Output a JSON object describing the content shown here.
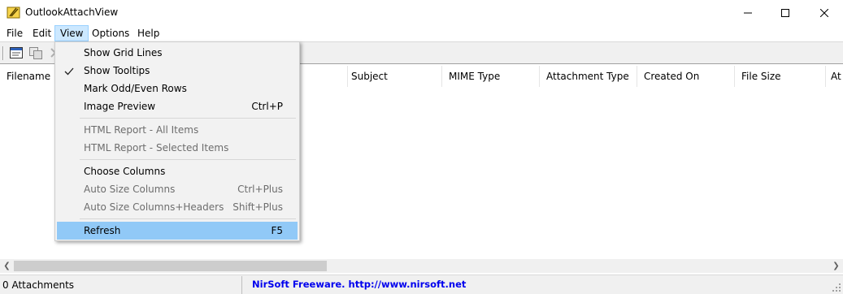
{
  "window": {
    "title": "OutlookAttachView",
    "controls": {
      "minimize": "minimize-icon",
      "maximize": "maximize-icon",
      "close": "close-icon"
    }
  },
  "menubar": {
    "items": [
      {
        "label": "File"
      },
      {
        "label": "Edit"
      },
      {
        "label": "View",
        "active": true
      },
      {
        "label": "Options"
      },
      {
        "label": "Help"
      }
    ]
  },
  "toolbar": {
    "buttons": [
      "properties-icon",
      "copy-icon",
      "delete-icon"
    ]
  },
  "columns": [
    "Filename",
    "Subject",
    "MIME Type",
    "Attachment Type",
    "Created On",
    "File Size",
    "At"
  ],
  "view_menu": {
    "items": [
      {
        "label": "Show Grid Lines",
        "shortcut": "",
        "enabled": true,
        "checked": false
      },
      {
        "label": "Show Tooltips",
        "shortcut": "",
        "enabled": true,
        "checked": true
      },
      {
        "label": "Mark Odd/Even Rows",
        "shortcut": "",
        "enabled": true,
        "checked": false
      },
      {
        "label": "Image Preview",
        "shortcut": "Ctrl+P",
        "enabled": true,
        "checked": false
      },
      {
        "label": "HTML Report - All Items",
        "shortcut": "",
        "enabled": false,
        "checked": false
      },
      {
        "label": "HTML Report - Selected Items",
        "shortcut": "",
        "enabled": false,
        "checked": false
      },
      {
        "label": "Choose Columns",
        "shortcut": "",
        "enabled": true,
        "checked": false
      },
      {
        "label": "Auto Size Columns",
        "shortcut": "Ctrl+Plus",
        "enabled": false,
        "checked": false
      },
      {
        "label": "Auto Size Columns+Headers",
        "shortcut": "Shift+Plus",
        "enabled": false,
        "checked": false
      },
      {
        "label": "Refresh",
        "shortcut": "F5",
        "enabled": true,
        "checked": false,
        "highlighted": true
      }
    ]
  },
  "statusbar": {
    "count": "0 Attachments",
    "credit": "NirSoft Freeware.  http://www.nirsoft.net"
  },
  "colors": {
    "menu_active_bg": "#cce8ff",
    "menu_highlight_bg": "#91c9f7",
    "link": "#0000ee"
  }
}
